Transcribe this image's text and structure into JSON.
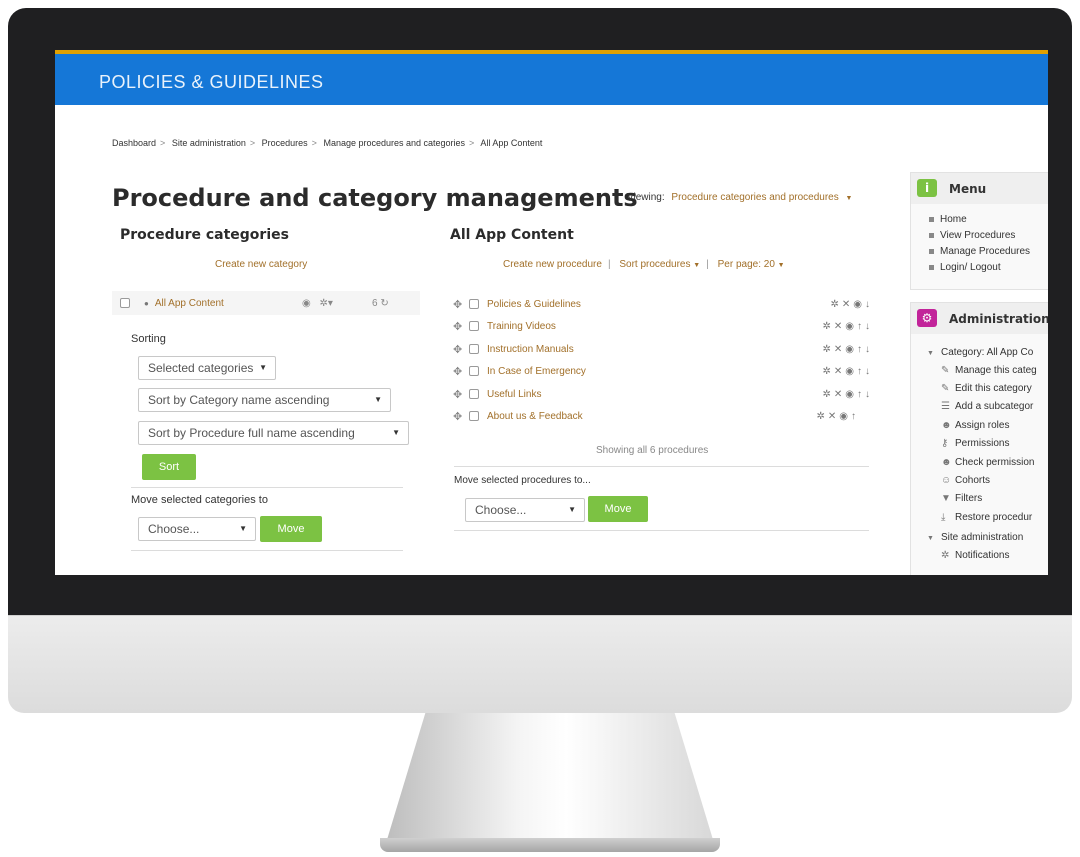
{
  "site": {
    "title": "POLICIES & GUIDELINES",
    "colors": {
      "header": "#1577d7",
      "accent_link": "#a2702a",
      "button": "#7cc243",
      "menu_icon": "#7cc243",
      "admin_icon": "#c2249a"
    }
  },
  "breadcrumb": [
    "Dashboard",
    "Site administration",
    "Procedures",
    "Manage procedures and categories",
    "All App Content"
  ],
  "page": {
    "title": "Procedure and category managements",
    "viewing_label": "Viewing:",
    "viewing_value": "Procedure categories and procedures"
  },
  "categories": {
    "heading": "Procedure categories",
    "create_link": "Create new category",
    "row": {
      "name": "All App Content",
      "count": "6",
      "icons": [
        "eye-icon",
        "gear-icon"
      ]
    },
    "sorting": {
      "label": "Sorting",
      "scope": "Selected categories",
      "by_category": "Sort by Category name ascending",
      "by_procedure": "Sort by Procedure full name ascending",
      "button": "Sort"
    },
    "move": {
      "label": "Move selected categories to",
      "choose": "Choose...",
      "button": "Move"
    }
  },
  "procedures": {
    "heading": "All App Content",
    "create_link": "Create new procedure",
    "sort_link": "Sort procedures",
    "per_page": "Per page: 20",
    "items": [
      {
        "name": "Policies & Guidelines",
        "actions": [
          "gear-icon",
          "delete-icon",
          "eye-icon",
          "arrow-down-icon"
        ]
      },
      {
        "name": "Training Videos",
        "actions": [
          "gear-icon",
          "delete-icon",
          "eye-icon",
          "arrow-up-icon",
          "arrow-down-icon"
        ]
      },
      {
        "name": "Instruction Manuals",
        "actions": [
          "gear-icon",
          "delete-icon",
          "eye-icon",
          "arrow-up-icon",
          "arrow-down-icon"
        ]
      },
      {
        "name": "In Case of Emergency",
        "actions": [
          "gear-icon",
          "delete-icon",
          "eye-icon",
          "arrow-up-icon",
          "arrow-down-icon"
        ]
      },
      {
        "name": "Useful Links",
        "actions": [
          "gear-icon",
          "delete-icon",
          "eye-icon",
          "arrow-up-icon",
          "arrow-down-icon"
        ]
      },
      {
        "name": "About us & Feedback",
        "actions": [
          "gear-icon",
          "delete-icon",
          "eye-icon",
          "arrow-up-icon"
        ]
      }
    ],
    "showing": "Showing all 6 procedures",
    "move": {
      "label": "Move selected procedures to...",
      "choose": "Choose...",
      "button": "Move"
    }
  },
  "sidebar": {
    "menu": {
      "title": "Menu",
      "items": [
        "Home",
        "View Procedures",
        "Manage Procedures",
        "Login/ Logout"
      ]
    },
    "admin": {
      "title": "Administration",
      "category": "Category: All App Co",
      "items": [
        {
          "label": "Manage this categ",
          "icon": "pencil-icon"
        },
        {
          "label": "Edit this category",
          "icon": "pencil-icon"
        },
        {
          "label": "Add a subcategor",
          "icon": "list-icon"
        },
        {
          "label": "Assign roles",
          "icon": "user-icon"
        },
        {
          "label": "Permissions",
          "icon": "key-icon"
        },
        {
          "label": "Check permission",
          "icon": "user-check-icon"
        },
        {
          "label": "Cohorts",
          "icon": "users-icon"
        },
        {
          "label": "Filters",
          "icon": "filter-icon"
        },
        {
          "label": "Restore procedur",
          "icon": "download-icon"
        }
      ],
      "site_admin": "Site administration",
      "notifications": "Notifications"
    }
  }
}
